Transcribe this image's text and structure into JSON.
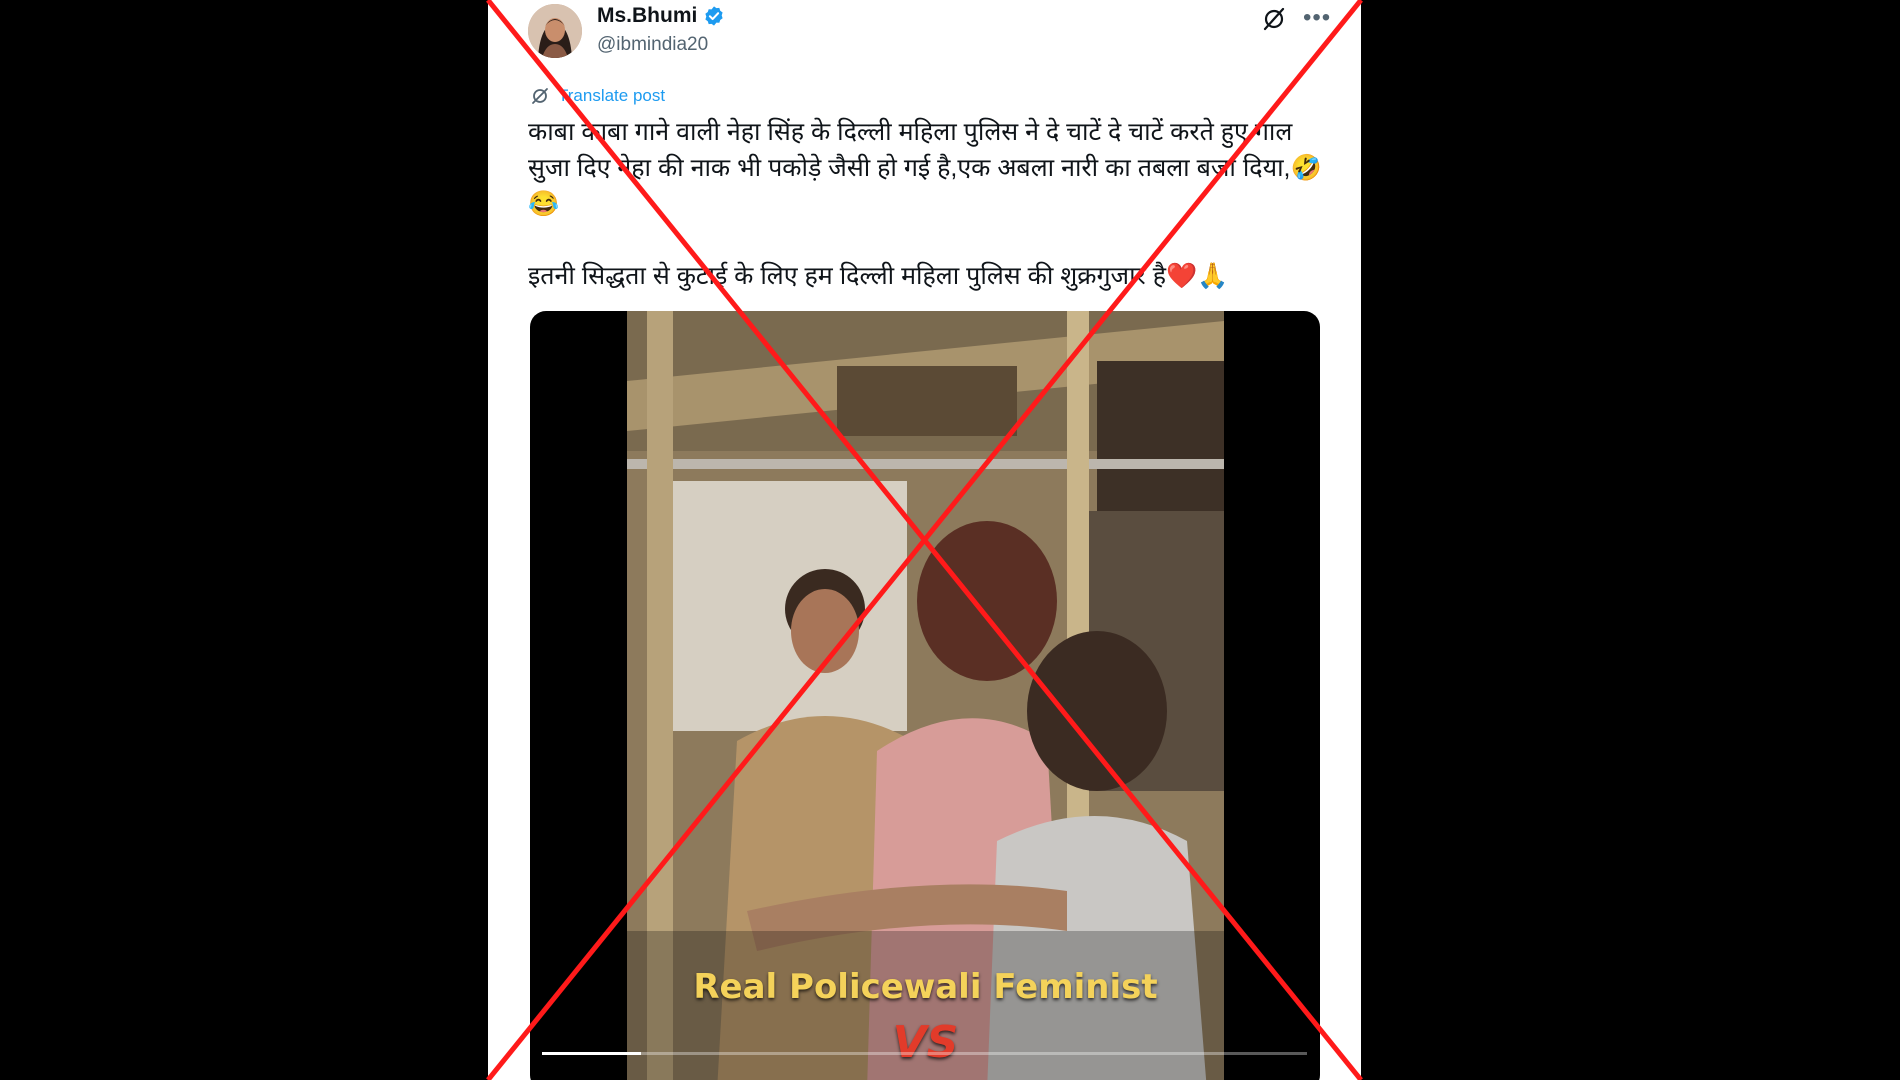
{
  "post": {
    "display_name": "Ms.Bhumi",
    "handle": "@ibmindia20",
    "verified": true,
    "translate_label": "Translate post",
    "text": "काबा काबा गाने वाली नेहा सिंह के दिल्ली महिला पुलिस ने दे चाटें दे चाटें करते हुए गाल\nसुजा दिए नेहा की नाक भी पकोड़े जैसी हो गई है,एक अबला नारी का तबला बजा दिया,🤣\n😂\n\nइतनी सिद्धता से कुटाई के लिए हम दिल्ली महिला पुलिस की शुक्रगुजार है❤️🙏",
    "icons": [
      "grok-icon",
      "more-icon",
      "translate-icon",
      "verified-badge-icon"
    ]
  },
  "media": {
    "caption": "Real Policewali Feminist",
    "overlay_text": "VS",
    "progress": 0.13
  },
  "overlay": {
    "type": "red-cross",
    "color": "#ff1a1a"
  },
  "colors": {
    "background": "#000000",
    "card": "#ffffff",
    "accent": "#1d9bf0",
    "text": "#0f1419",
    "muted": "#536471"
  }
}
